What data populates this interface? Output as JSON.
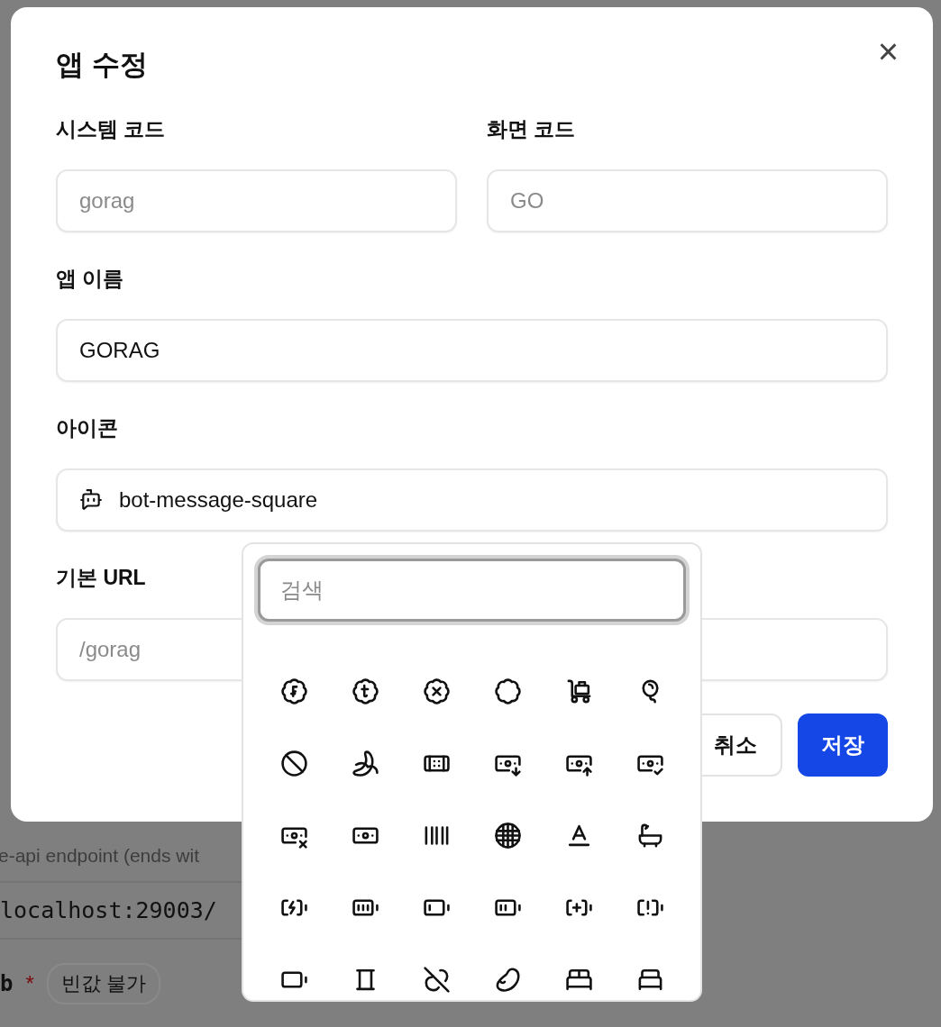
{
  "background": {
    "hint": "e-api endpoint (ends wit",
    "value": "localhost:29003/",
    "next_label": "b",
    "required_mark": "*",
    "badge": "빈값 불가"
  },
  "dialog": {
    "title": "앱 수정",
    "close": "×",
    "rows": [
      [
        {
          "label": "시스템 코드",
          "value": "gorag",
          "disabled": true,
          "kind": "text"
        },
        {
          "label": "화면 코드",
          "value": "GO",
          "disabled": true,
          "kind": "text"
        }
      ],
      [
        {
          "label": "앱 이름",
          "value": "GORAG",
          "disabled": false,
          "kind": "text"
        }
      ],
      [
        {
          "label": "아이콘",
          "value": "bot-message-square",
          "disabled": false,
          "kind": "icon"
        }
      ],
      [
        {
          "label": "기본 URL",
          "value": "/gorag",
          "disabled": true,
          "kind": "text"
        }
      ]
    ],
    "buttons": [
      {
        "label": "취소",
        "kind": "secondary"
      },
      {
        "label": "저장",
        "kind": "primary"
      }
    ]
  },
  "icon_picker": {
    "search_placeholder": "검색",
    "focused": true
  }
}
